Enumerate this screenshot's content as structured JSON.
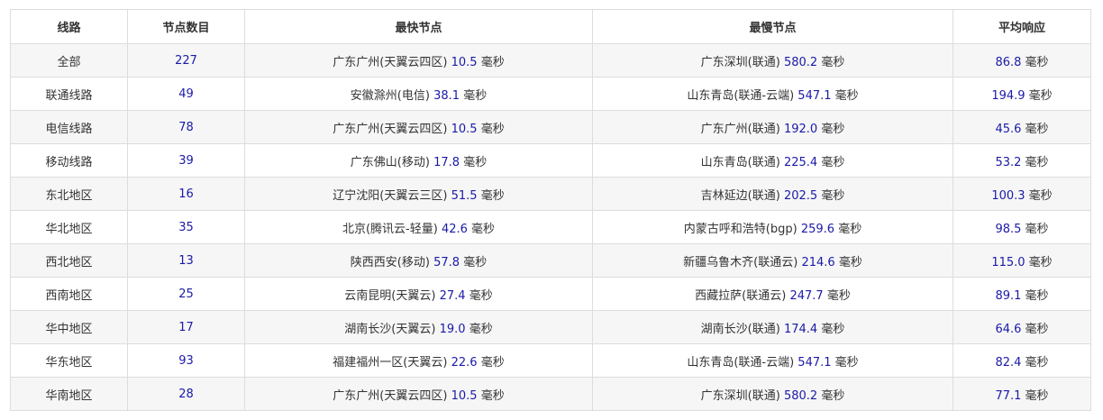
{
  "headers": [
    "线路",
    "节点数目",
    "最快节点",
    "最慢节点",
    "平均响应"
  ],
  "unit": "毫秒",
  "rows": [
    {
      "route": "全部",
      "count": "227",
      "fast_loc": "广东广州(天翼云四区)",
      "fast_ms": "10.5",
      "slow_loc": "广东深圳(联通)",
      "slow_ms": "580.2",
      "avg_ms": "86.8"
    },
    {
      "route": "联通线路",
      "count": "49",
      "fast_loc": "安徽滁州(电信)",
      "fast_ms": "38.1",
      "slow_loc": "山东青岛(联通-云端)",
      "slow_ms": "547.1",
      "avg_ms": "194.9"
    },
    {
      "route": "电信线路",
      "count": "78",
      "fast_loc": "广东广州(天翼云四区)",
      "fast_ms": "10.5",
      "slow_loc": "广东广州(联通)",
      "slow_ms": "192.0",
      "avg_ms": "45.6"
    },
    {
      "route": "移动线路",
      "count": "39",
      "fast_loc": "广东佛山(移动)",
      "fast_ms": "17.8",
      "slow_loc": "山东青岛(联通)",
      "slow_ms": "225.4",
      "avg_ms": "53.2"
    },
    {
      "route": "东北地区",
      "count": "16",
      "fast_loc": "辽宁沈阳(天翼云三区)",
      "fast_ms": "51.5",
      "slow_loc": "吉林延边(联通)",
      "slow_ms": "202.5",
      "avg_ms": "100.3"
    },
    {
      "route": "华北地区",
      "count": "35",
      "fast_loc": "北京(腾讯云-轻量)",
      "fast_ms": "42.6",
      "slow_loc": "内蒙古呼和浩特(bgp)",
      "slow_ms": "259.6",
      "avg_ms": "98.5"
    },
    {
      "route": "西北地区",
      "count": "13",
      "fast_loc": "陕西西安(移动)",
      "fast_ms": "57.8",
      "slow_loc": "新疆乌鲁木齐(联通云)",
      "slow_ms": "214.6",
      "avg_ms": "115.0"
    },
    {
      "route": "西南地区",
      "count": "25",
      "fast_loc": "云南昆明(天翼云)",
      "fast_ms": "27.4",
      "slow_loc": "西藏拉萨(联通云)",
      "slow_ms": "247.7",
      "avg_ms": "89.1"
    },
    {
      "route": "华中地区",
      "count": "17",
      "fast_loc": "湖南长沙(天翼云)",
      "fast_ms": "19.0",
      "slow_loc": "湖南长沙(联通)",
      "slow_ms": "174.4",
      "avg_ms": "64.6"
    },
    {
      "route": "华东地区",
      "count": "93",
      "fast_loc": "福建福州一区(天翼云)",
      "fast_ms": "22.6",
      "slow_loc": "山东青岛(联通-云端)",
      "slow_ms": "547.1",
      "avg_ms": "82.4"
    },
    {
      "route": "华南地区",
      "count": "28",
      "fast_loc": "广东广州(天翼云四区)",
      "fast_ms": "10.5",
      "slow_loc": "广东深圳(联通)",
      "slow_ms": "580.2",
      "avg_ms": "77.1"
    }
  ]
}
